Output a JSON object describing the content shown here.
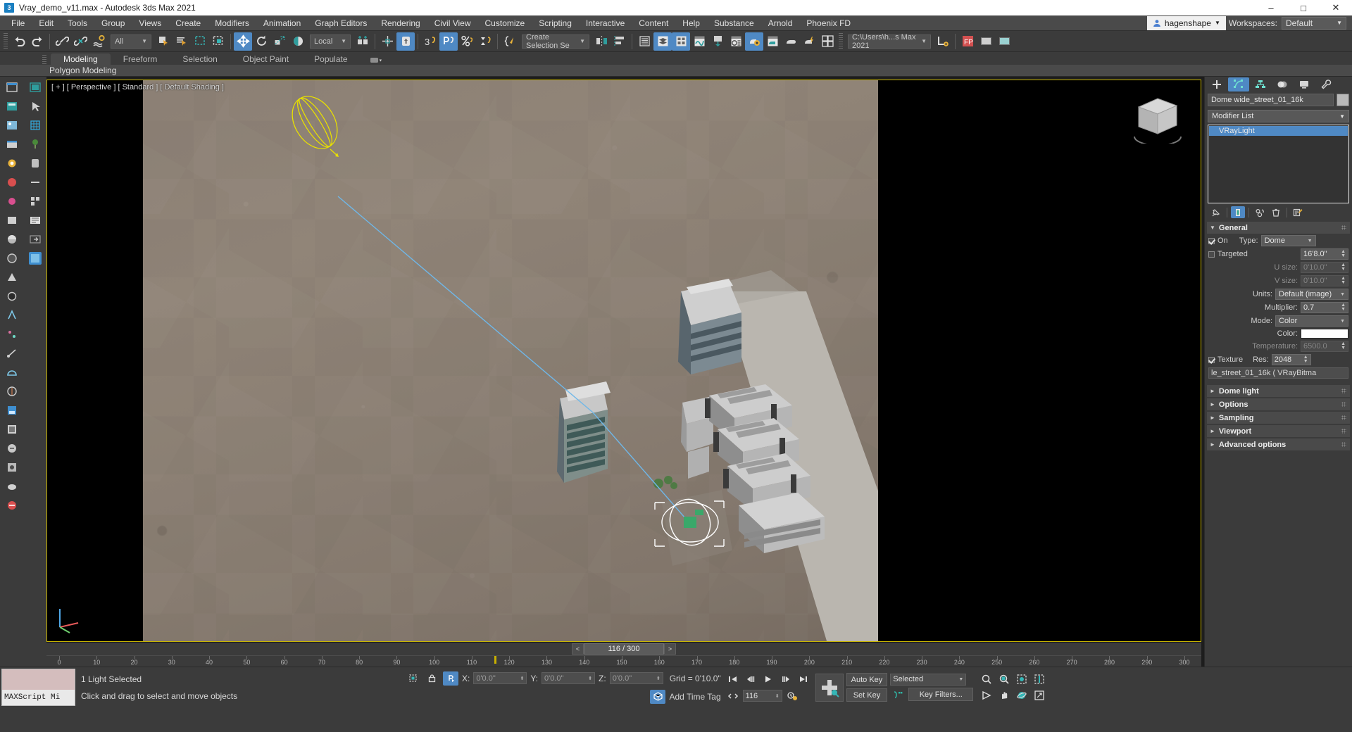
{
  "window": {
    "title": "Vray_demo_v11.max - Autodesk 3ds Max 2021",
    "app_icon": "3dsmax-icon",
    "minimize": "–",
    "maximize": "□",
    "close": "✕"
  },
  "menu": {
    "items": [
      "File",
      "Edit",
      "Tools",
      "Group",
      "Views",
      "Create",
      "Modifiers",
      "Animation",
      "Graph Editors",
      "Rendering",
      "Civil View",
      "Customize",
      "Scripting",
      "Interactive",
      "Content",
      "Help",
      "Substance",
      "Arnold",
      "Phoenix FD"
    ],
    "user_name": "hagenshape",
    "workspaces_label": "Workspaces:",
    "workspace_value": "Default"
  },
  "toolbar": {
    "selection_filter": "All",
    "reference_coord": "Local",
    "named_selection_set": "Create Selection Se",
    "project_folder": "C:\\Users\\h...s Max 2021",
    "icons": [
      "undo-icon",
      "redo-icon",
      "select-link-icon",
      "unlink-icon",
      "bind-to-space-warp-icon",
      "select-object-icon",
      "select-by-name-icon",
      "rectangular-selection-region-icon",
      "window-crossing-icon",
      "select-and-move-icon",
      "select-and-rotate-icon",
      "select-and-scale-icon",
      "select-and-place-icon",
      "use-pivot-point-center-icon",
      "select-and-manipulate-icon",
      "snaps-toggle-icon",
      "angle-snap-toggle-icon",
      "percent-snap-toggle-icon",
      "spinner-snap-toggle-icon",
      "edit-named-selection-sets-icon",
      "mirror-icon",
      "align-icon",
      "layer-explorer-icon",
      "scene-explorer-icon",
      "toggle-ribbon-icon",
      "curve-editor-icon",
      "schematic-view-icon",
      "material-editor-icon",
      "render-setup-icon",
      "rendered-frame-window-icon",
      "render-production-icon",
      "render-iterative-icon",
      "open-asset-tracking-icon",
      "project-folder-icon"
    ]
  },
  "ribbon": {
    "tabs": [
      "Modeling",
      "Freeform",
      "Selection",
      "Object Paint",
      "Populate"
    ],
    "active_tab": "Modeling",
    "panel_label": "Polygon Modeling"
  },
  "viewport": {
    "label": "[ + ] [ Perspective ] [ Standard ] [ Default Shading ]",
    "label_parts": [
      "[ + ]",
      "[ Perspective ]",
      "[ Standard ]",
      "[ Default Shading ]"
    ],
    "viewcube_name": "view-cube",
    "axis_tripod_name": "axis-tripod-icon",
    "selection_highlight_color": "#ffffff",
    "light_gizmo_color": "#e8e000",
    "light_target_line_color": "#6fb7e8"
  },
  "timeline": {
    "current_frame_label": "116 / 300",
    "prev_frame_arrow": "<",
    "next_frame_arrow": ">",
    "tick_labels": [
      0,
      10,
      20,
      30,
      40,
      50,
      60,
      70,
      80,
      90,
      100,
      110,
      120,
      130,
      140,
      150,
      160,
      170,
      180,
      190,
      200,
      210,
      220,
      230,
      240,
      250,
      260,
      270,
      280,
      290,
      300
    ],
    "playhead_frame": 116,
    "range_start": 0,
    "range_end": 300
  },
  "command_panel": {
    "tabs": [
      "create-tab",
      "modify-tab",
      "hierarchy-tab",
      "motion-tab",
      "display-tab",
      "utilities-tab"
    ],
    "active_tab": "modify-tab",
    "object_name": "Dome wide_street_01_16k",
    "color_swatch": "#b9b9b9",
    "modifier_list_label": "Modifier List",
    "stack_items": [
      {
        "label": "VRayLight",
        "selected": true
      }
    ],
    "stack_tools": [
      "pin-stack-icon",
      "show-end-result-icon",
      "make-unique-icon",
      "remove-modifier-icon",
      "configure-modifier-sets-icon"
    ],
    "rollouts": [
      {
        "name": "General",
        "open": true
      },
      {
        "name": "Dome light",
        "open": false
      },
      {
        "name": "Options",
        "open": false
      },
      {
        "name": "Sampling",
        "open": false
      },
      {
        "name": "Viewport",
        "open": false
      },
      {
        "name": "Advanced options",
        "open": false
      }
    ],
    "general": {
      "on_label": "On",
      "on_checked": true,
      "type_label": "Type:",
      "type_value": "Dome",
      "targeted_label": "Targeted",
      "targeted_checked": false,
      "target_dist_value": "16'8.0\"",
      "u_size_label": "U size:",
      "u_size_value": "0'10.0\"",
      "v_size_label": "V size:",
      "v_size_value": "0'10.0\"",
      "units_label": "Units:",
      "units_value": "Default (image)",
      "multiplier_label": "Multiplier:",
      "multiplier_value": "0.7",
      "mode_label": "Mode:",
      "mode_value": "Color",
      "color_label": "Color:",
      "color_value": "#ffffff",
      "temperature_label": "Temperature:",
      "temperature_value": "6500.0",
      "texture_label": "Texture",
      "texture_checked": true,
      "res_label": "Res:",
      "res_value": "2048",
      "texture_map_button": "le_street_01_16k  ( VRayBitma"
    }
  },
  "status_bar": {
    "maxscript_mini_listener": "MAXScript Mi",
    "selection_status": "1 Light Selected",
    "prompt": "Click and drag to select and move objects",
    "x_label": "X:",
    "x_value": "0'0.0\"",
    "y_label": "Y:",
    "y_value": "0'0.0\"",
    "z_label": "Z:",
    "z_value": "0'0.0\"",
    "grid_label": "Grid = 0'10.0\"",
    "add_time_tag": "Add Time Tag",
    "auto_key": "Auto Key",
    "set_key": "Set Key",
    "key_mode_value": "Selected",
    "key_filters": "Key Filters...",
    "current_frame": "116",
    "icons": [
      "selection-lock-icon",
      "absolute-relative-transform-icon",
      "isolate-selection-icon",
      "go-to-start-icon",
      "previous-frame-icon",
      "play-animation-icon",
      "next-frame-icon",
      "go-to-end-icon",
      "key-mode-toggle-icon",
      "time-configuration-icon",
      "set-key-button-icon",
      "zoom-icon",
      "zoom-all-icon",
      "zoom-extents-icon",
      "zoom-region-icon",
      "field-of-view-icon",
      "pan-view-icon",
      "orbit-icon",
      "maximize-viewport-toggle-icon"
    ]
  },
  "left_toolbars": {
    "column_a": [
      "command-panel-icon",
      "object-paint-icon",
      "render-frame-icon",
      "display-layer-icon",
      "light-lister-icon",
      "material-icon",
      "sun-positioner-icon",
      "box-icon",
      "sphere-icon",
      "cone-icon",
      "torus-icon",
      "geosphere-icon",
      "helix-icon",
      "point-icon",
      "tape-icon",
      "protractor-icon",
      "compass-icon",
      "shape-line-icon",
      "vray-proxy-icon",
      "vray-fur-icon",
      "vray-plane-icon",
      "vray-sphere-icon",
      "vray-clipper-icon"
    ],
    "column_b": [
      "snapshot-icon",
      "arrow-icon",
      "grid-icon",
      "foliage-icon",
      "pipe-icon",
      "divider-icon",
      "array-icon",
      "selection-sets-icon"
    ]
  }
}
